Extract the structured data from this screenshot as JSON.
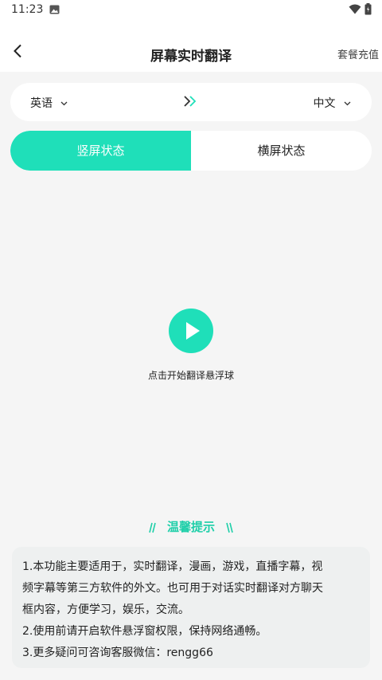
{
  "status_bar": {
    "time": "11:23",
    "icons": [
      "image-icon",
      "wifi-icon",
      "battery-icon"
    ]
  },
  "nav": {
    "title": "屏幕实时翻译",
    "action": "套餐充值"
  },
  "languages": {
    "source": "英语",
    "target": "中文"
  },
  "modes": {
    "portrait": "竖屏状态",
    "landscape": "横屏状态",
    "selected": "portrait"
  },
  "player": {
    "caption": "点击开始翻译悬浮球"
  },
  "tips": {
    "title": "温馨提示",
    "lines": [
      "1.本功能主要适用于，实时翻译，漫画，游戏，直播字幕，视",
      "频字幕等第三方软件的外文。也可用于对话实时翻译对方聊天",
      "框内容，方便学习，娱乐，交流。",
      "2.使用前请开启软件悬浮窗权限，保持网络通畅。",
      "3.更多疑问可咨询客服微信：rengg66"
    ]
  },
  "colors": {
    "accent": "#1fdfb9",
    "background": "#f5f5f5",
    "card": "#ffffff",
    "tips_card": "#eef0f0"
  }
}
